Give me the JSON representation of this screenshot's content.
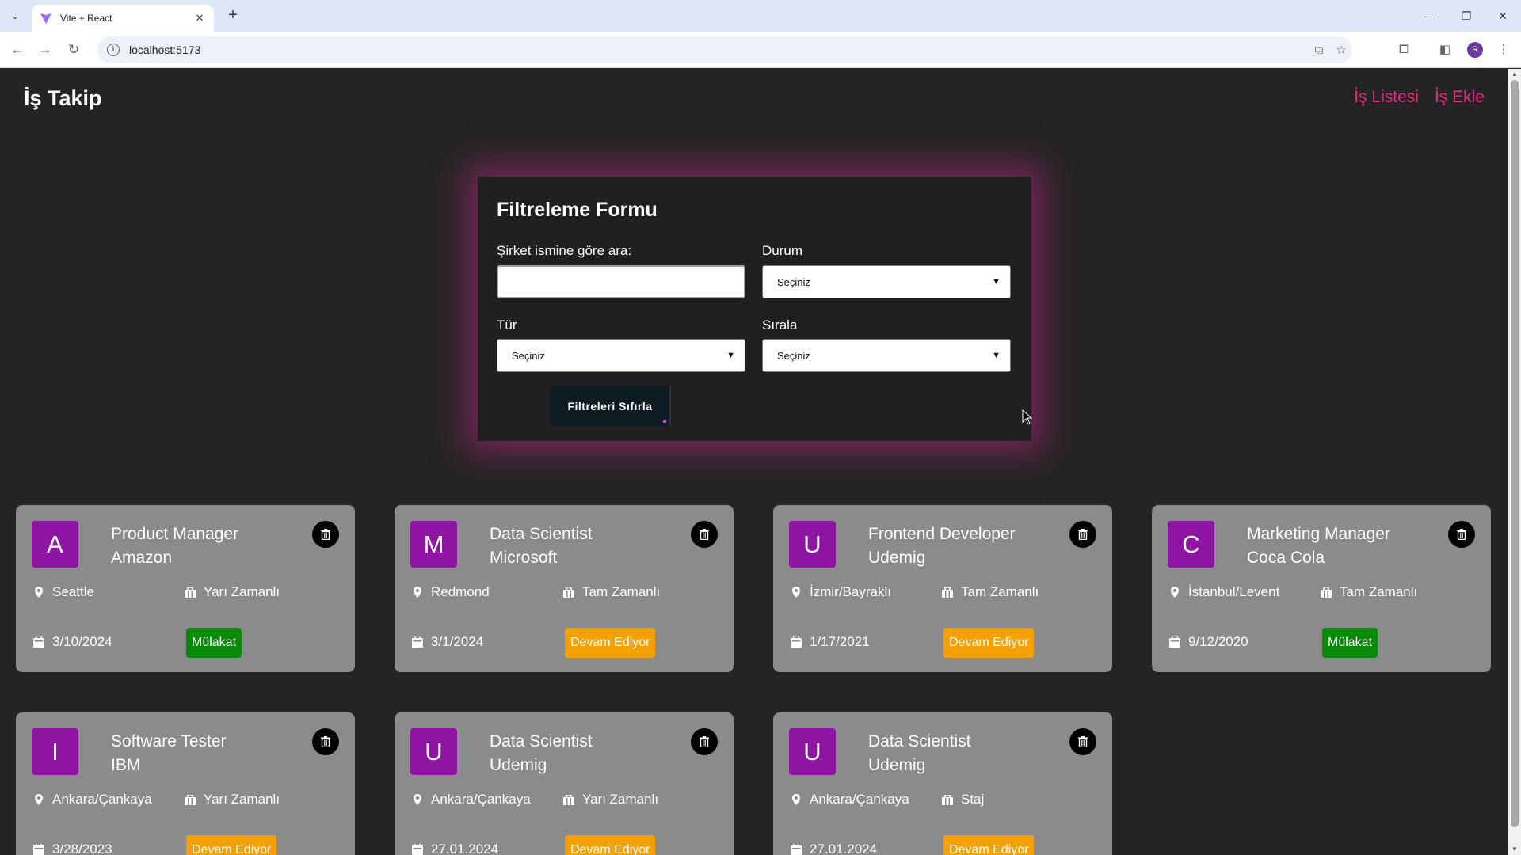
{
  "browser": {
    "tab_title": "Vite + React",
    "url": "localhost:5173",
    "profile_initial": "R"
  },
  "nav": {
    "brand": "İş Takip",
    "links": [
      "İş Listesi",
      "İş Ekle"
    ]
  },
  "filter": {
    "title": "Filtreleme Formu",
    "search_label": "Şirket ismine göre ara:",
    "search_value": "",
    "status_label": "Durum",
    "status_value": "Seçiniz",
    "type_label": "Tür",
    "type_value": "Seçiniz",
    "sort_label": "Sırala",
    "sort_value": "Seçiniz",
    "reset_label": "Filtreleri Sıfırla"
  },
  "jobs": [
    {
      "initial": "A",
      "position": "Product Manager",
      "company": "Amazon",
      "location": "Seattle",
      "type": "Yarı Zamanlı",
      "date": "3/10/2024",
      "status": "Mülakat",
      "status_color": "#0a8a0a"
    },
    {
      "initial": "M",
      "position": "Data Scientist",
      "company": "Microsoft",
      "location": "Redmond",
      "type": "Tam Zamanlı",
      "date": "3/1/2024",
      "status": "Devam Ediyor",
      "status_color": "#f4a007"
    },
    {
      "initial": "U",
      "position": "Frontend Developer",
      "company": "Udemig",
      "location": "İzmir/Bayraklı",
      "type": "Tam Zamanlı",
      "date": "1/17/2021",
      "status": "Devam Ediyor",
      "status_color": "#f4a007"
    },
    {
      "initial": "C",
      "position": "Marketing Manager",
      "company": "Coca Cola",
      "location": "İstanbul/Levent",
      "type": "Tam Zamanlı",
      "date": "9/12/2020",
      "status": "Mülakat",
      "status_color": "#0a8a0a"
    },
    {
      "initial": "I",
      "position": "Software Tester",
      "company": "IBM",
      "location": "Ankara/Çankaya",
      "type": "Yarı Zamanlı",
      "date": "3/28/2023",
      "status": "Devam Ediyor",
      "status_color": "#f4a007"
    },
    {
      "initial": "U",
      "position": "Data Scientist",
      "company": "Udemig",
      "location": "Ankara/Çankaya",
      "type": "Yarı Zamanlı",
      "date": "27.01.2024",
      "status": "Devam Ediyor",
      "status_color": "#f4a007"
    },
    {
      "initial": "U",
      "position": "Data Scientist",
      "company": "Udemig",
      "location": "Ankara/Çankaya",
      "type": "Staj",
      "date": "27.01.2024",
      "status": "Devam Ediyor",
      "status_color": "#f4a007"
    }
  ],
  "colors": {
    "accent": "#e0307f",
    "avatar": "#8e15a1",
    "card": "#8b8b8b"
  },
  "icons": [
    "location-icon",
    "briefcase-icon",
    "calendar-icon",
    "trash-icon"
  ]
}
